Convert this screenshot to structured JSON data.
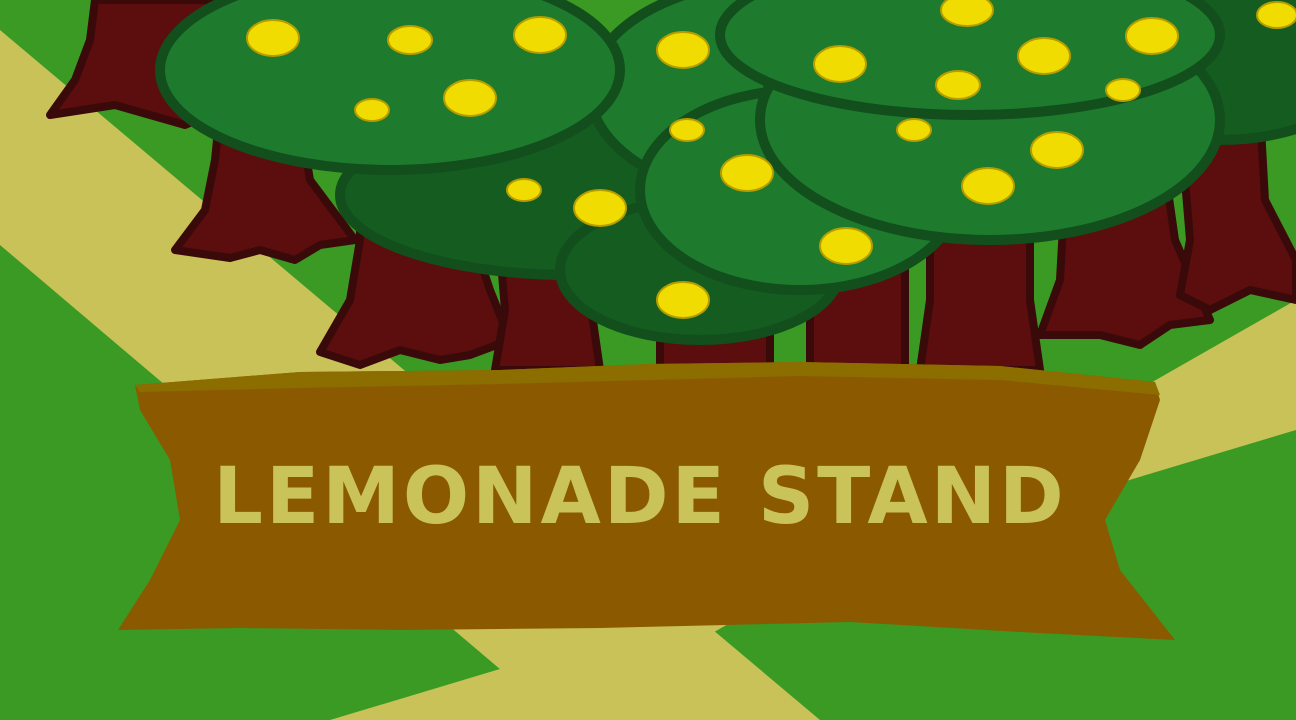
{
  "game": {
    "title": "LEMONADE STAND"
  },
  "colors": {
    "grass": "#3a9a23",
    "path": "#c8c258",
    "sign_wood": "#8b5a00",
    "sign_edge": "#8c6d00",
    "title_text": "#c9c35a",
    "trunk": "#5c0d0d",
    "trunk_outline": "#3a0a0a",
    "canopy_light": "#1e7b2d",
    "canopy_dark": "#155c20",
    "canopy_outline": "#124f1c",
    "lemon": "#f0dc00"
  },
  "scene": {
    "tree_count": 6,
    "lemon_count": 24
  }
}
